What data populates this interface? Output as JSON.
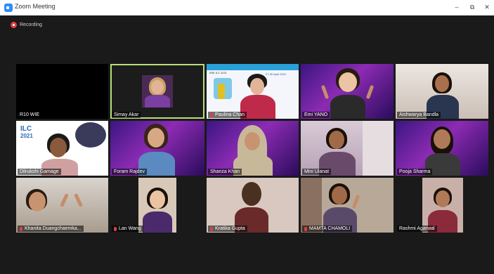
{
  "window": {
    "title": "Zoom Meeting",
    "minimize": "–",
    "maximize": "⧉",
    "close": "✕"
  },
  "recording": {
    "label": "Recording"
  },
  "participants": [
    {
      "name": "R10 WIE",
      "muted": false
    },
    {
      "name": "Simay Akar",
      "muted": false,
      "speaking": true
    },
    {
      "name": "Paulina Chan",
      "muted": true
    },
    {
      "name": "Emi YANO",
      "muted": false
    },
    {
      "name": "Aishwarya Bandla",
      "muted": false
    },
    {
      "name": "Dilrukshi Gamage",
      "muted": false
    },
    {
      "name": "Foram Rajdev",
      "muted": false
    },
    {
      "name": "Shanza Khan",
      "muted": false
    },
    {
      "name": "Mini Ulanat",
      "muted": false
    },
    {
      "name": "Pooja Sharma",
      "muted": false
    },
    {
      "name": "Khanita Duangchaemkarn",
      "display": "Khanita Duangchaemka...",
      "muted": true
    },
    {
      "name": "Lan Wang",
      "muted": true
    },
    {
      "name": "Kratika Gupta",
      "muted": true
    },
    {
      "name": "MAMTA CHAMOLI",
      "muted": true
    },
    {
      "name": "Rashmi Agarwal",
      "muted": false
    }
  ],
  "slide_text": {
    "header": "WIE ILC 2021",
    "dates": "27-30 April 2021",
    "ilc_badge": "ILC",
    "ilc_year": "2021"
  }
}
